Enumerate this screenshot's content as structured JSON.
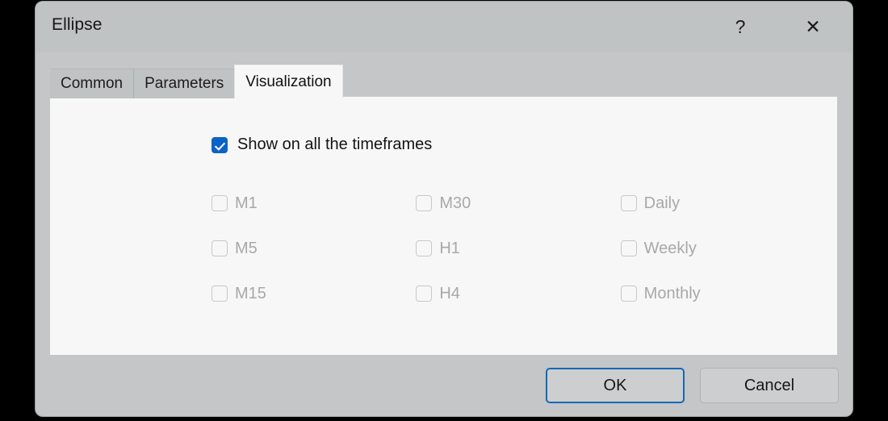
{
  "window": {
    "title": "Ellipse",
    "help_icon": "question-mark-icon",
    "help_glyph": "?",
    "close_icon": "close-icon",
    "close_glyph": "✕"
  },
  "tabs": [
    {
      "label": "Common",
      "active": false
    },
    {
      "label": "Parameters",
      "active": false
    },
    {
      "label": "Visualization",
      "active": true
    }
  ],
  "visualization": {
    "master": {
      "label": "Show on all the timeframes",
      "checked": true
    },
    "timeframes": [
      [
        {
          "label": "M1",
          "checked": false,
          "disabled": true
        },
        {
          "label": "M30",
          "checked": false,
          "disabled": true
        },
        {
          "label": "Daily",
          "checked": false,
          "disabled": true
        }
      ],
      [
        {
          "label": "M5",
          "checked": false,
          "disabled": true
        },
        {
          "label": "H1",
          "checked": false,
          "disabled": true
        },
        {
          "label": "Weekly",
          "checked": false,
          "disabled": true
        }
      ],
      [
        {
          "label": "M15",
          "checked": false,
          "disabled": true
        },
        {
          "label": "H4",
          "checked": false,
          "disabled": true
        },
        {
          "label": "Monthly",
          "checked": false,
          "disabled": true
        }
      ]
    ]
  },
  "footer": {
    "ok_label": "OK",
    "cancel_label": "Cancel"
  },
  "colors": {
    "accent": "#0b63c8",
    "focus_border": "#1368b5",
    "dialog_bg": "#c4c6c7",
    "titlebar_bg": "#c0c3c4",
    "panel_bg": "#f7f7f7",
    "disabled_text": "#a8a8a8",
    "button_bg": "#cccecf"
  }
}
